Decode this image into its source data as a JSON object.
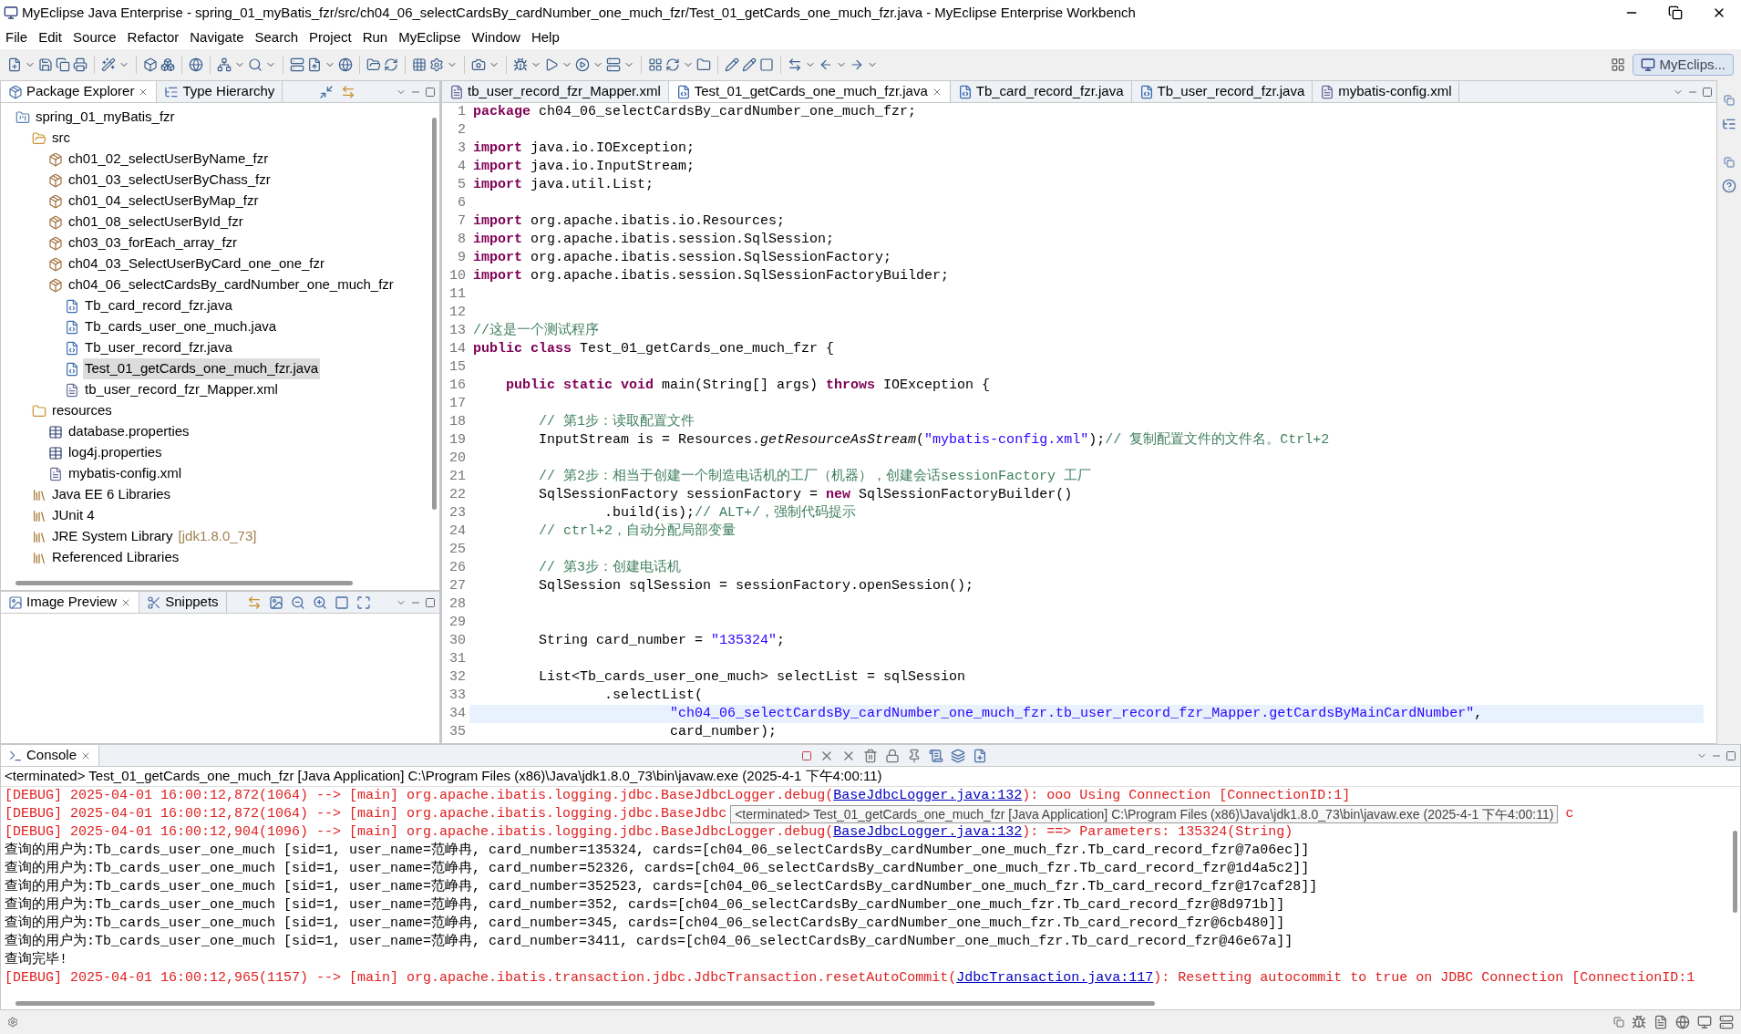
{
  "window": {
    "title": "MyEclipse Java Enterprise - spring_01_myBatis_fzr/src/ch04_06_selectCardsBy_cardNumber_one_much_fzr/Test_01_getCards_one_much_fzr.java - MyEclipse Enterprise Workbench"
  },
  "menu": [
    "File",
    "Edit",
    "Source",
    "Refactor",
    "Navigate",
    "Search",
    "Project",
    "Run",
    "MyEclipse",
    "Window",
    "Help"
  ],
  "perspective": {
    "label": "MyEclips..."
  },
  "explorer": {
    "tabs": [
      {
        "label": "Package Explorer",
        "selected": true
      },
      {
        "label": "Type Hierarchy",
        "selected": false
      }
    ],
    "tree": [
      {
        "label": "spring_01_myBatis_fzr",
        "kind": "project",
        "selected": false,
        "children": [
          {
            "label": "src",
            "kind": "source",
            "selected": false,
            "children": [
              {
                "label": "ch01_02_selectUserByName_fzr",
                "kind": "package",
                "selected": false
              },
              {
                "label": "ch01_03_selectUserByChass_fzr",
                "kind": "package",
                "selected": false
              },
              {
                "label": "ch01_04_selectUserByMap_fzr",
                "kind": "package",
                "selected": false
              },
              {
                "label": "ch01_08_selectUserById_fzr",
                "kind": "package",
                "selected": false
              },
              {
                "label": "ch03_03_forEach_array_fzr",
                "kind": "package",
                "selected": false
              },
              {
                "label": "ch04_03_SelectUserByCard_one_one_fzr",
                "kind": "package",
                "selected": false
              },
              {
                "label": "ch04_06_selectCardsBy_cardNumber_one_much_fzr",
                "kind": "package",
                "selected": false,
                "children": [
                  {
                    "label": "Tb_card_record_fzr.java",
                    "kind": "java",
                    "selected": false
                  },
                  {
                    "label": "Tb_cards_user_one_much.java",
                    "kind": "java",
                    "selected": false
                  },
                  {
                    "label": "Tb_user_record_fzr.java",
                    "kind": "java",
                    "selected": false
                  },
                  {
                    "label": "Test_01_getCards_one_much_fzr.java",
                    "kind": "java",
                    "selected": true
                  },
                  {
                    "label": "tb_user_record_fzr_Mapper.xml",
                    "kind": "xml",
                    "selected": false
                  }
                ]
              }
            ]
          },
          {
            "label": "resources",
            "kind": "folder",
            "selected": false,
            "children": [
              {
                "label": "database.properties",
                "kind": "properties",
                "selected": false
              },
              {
                "label": "log4j.properties",
                "kind": "properties",
                "selected": false
              },
              {
                "label": "mybatis-config.xml",
                "kind": "xml",
                "selected": false
              }
            ]
          },
          {
            "label": "Java EE 6 Libraries",
            "kind": "library",
            "selected": false
          },
          {
            "label": "JUnit 4",
            "kind": "library",
            "selected": false
          },
          {
            "label": "JRE System Library",
            "decoration": "[jdk1.8.0_73]",
            "kind": "library",
            "selected": false
          },
          {
            "label": "Referenced Libraries",
            "kind": "library",
            "selected": false
          }
        ]
      }
    ]
  },
  "preview": {
    "tabs": [
      {
        "label": "Image Preview",
        "selected": true
      },
      {
        "label": "Snippets",
        "selected": false
      }
    ]
  },
  "editor": {
    "tabs": [
      {
        "label": "tb_user_record_fzr_Mapper.xml",
        "kind": "xml",
        "selected": false
      },
      {
        "label": "Test_01_getCards_one_much_fzr.java",
        "kind": "java",
        "selected": true
      },
      {
        "label": "Tb_card_record_fzr.java",
        "kind": "java",
        "selected": false
      },
      {
        "label": "Tb_user_record_fzr.java",
        "kind": "java",
        "selected": false
      },
      {
        "label": "mybatis-config.xml",
        "kind": "xml",
        "selected": false
      }
    ],
    "lines": [
      {
        "n": "1",
        "current": false,
        "segs": [
          {
            "kind": "kw",
            "t": "package"
          },
          {
            "kind": "txt",
            "t": " ch04_06_selectCardsBy_cardNumber_one_much_fzr;"
          }
        ]
      },
      {
        "n": "2",
        "current": false
      },
      {
        "n": "3",
        "current": false,
        "segs": [
          {
            "kind": "kw",
            "t": "import"
          },
          {
            "kind": "txt",
            "t": " java.io.IOException;"
          }
        ]
      },
      {
        "n": "4",
        "current": false,
        "segs": [
          {
            "kind": "kw",
            "t": "import"
          },
          {
            "kind": "txt",
            "t": " java.io.InputStream;"
          }
        ]
      },
      {
        "n": "5",
        "current": false,
        "segs": [
          {
            "kind": "kw",
            "t": "import"
          },
          {
            "kind": "txt",
            "t": " java.util.List;"
          }
        ]
      },
      {
        "n": "6",
        "current": false
      },
      {
        "n": "7",
        "current": false,
        "segs": [
          {
            "kind": "kw",
            "t": "import"
          },
          {
            "kind": "txt",
            "t": " org.apache.ibatis.io.Resources;"
          }
        ]
      },
      {
        "n": "8",
        "current": false,
        "segs": [
          {
            "kind": "kw",
            "t": "import"
          },
          {
            "kind": "txt",
            "t": " org.apache.ibatis.session.SqlSession;"
          }
        ]
      },
      {
        "n": "9",
        "current": false,
        "segs": [
          {
            "kind": "kw",
            "t": "import"
          },
          {
            "kind": "txt",
            "t": " org.apache.ibatis.session.SqlSessionFactory;"
          }
        ]
      },
      {
        "n": "10",
        "current": false,
        "segs": [
          {
            "kind": "kw",
            "t": "import"
          },
          {
            "kind": "txt",
            "t": " org.apache.ibatis.session.SqlSessionFactoryBuilder;"
          }
        ]
      },
      {
        "n": "11",
        "current": false
      },
      {
        "n": "12",
        "current": false
      },
      {
        "n": "13",
        "current": false,
        "segs": [
          {
            "kind": "cm",
            "t": "//这是一个测试程序"
          }
        ]
      },
      {
        "n": "14",
        "current": false,
        "segs": [
          {
            "kind": "kw",
            "t": "public class"
          },
          {
            "kind": "txt",
            "t": " Test_01_getCards_one_much_fzr {"
          }
        ]
      },
      {
        "n": "15",
        "current": false
      },
      {
        "n": "16",
        "current": false,
        "segs": [
          {
            "kind": "kw",
            "t": "    public static void"
          },
          {
            "kind": "txt",
            "t": " main(String[] args) "
          },
          {
            "kind": "kw",
            "t": "throws"
          },
          {
            "kind": "txt",
            "t": " IOException {"
          }
        ]
      },
      {
        "n": "17",
        "current": false
      },
      {
        "n": "18",
        "current": false,
        "segs": [
          {
            "kind": "cm",
            "t": "        // 第1步：读取配置文件"
          }
        ]
      },
      {
        "n": "19",
        "current": false,
        "segs": [
          {
            "kind": "txt",
            "t": "        InputStream is = Resources."
          },
          {
            "kind": "it",
            "t": "getResourceAsStream"
          },
          {
            "kind": "txt",
            "t": "("
          },
          {
            "kind": "str",
            "t": "\"mybatis-config.xml\""
          },
          {
            "kind": "txt",
            "t": ");"
          },
          {
            "kind": "cm",
            "t": "// 复制配置文件的文件名。Ctrl+2"
          }
        ]
      },
      {
        "n": "20",
        "current": false
      },
      {
        "n": "21",
        "current": false,
        "segs": [
          {
            "kind": "cm",
            "t": "        // 第2步：相当于创建一个制造电话机的工厂（机器），创建会话sessionFactory 工厂"
          }
        ]
      },
      {
        "n": "22",
        "current": false,
        "segs": [
          {
            "kind": "txt",
            "t": "        SqlSessionFactory sessionFactory = "
          },
          {
            "kind": "kw",
            "t": "new"
          },
          {
            "kind": "txt",
            "t": " SqlSessionFactoryBuilder()"
          }
        ]
      },
      {
        "n": "23",
        "current": false,
        "segs": [
          {
            "kind": "txt",
            "t": "                .build(is);"
          },
          {
            "kind": "cm",
            "t": "// ALT+/，强制代码提示"
          }
        ]
      },
      {
        "n": "24",
        "current": false,
        "segs": [
          {
            "kind": "cm",
            "t": "        // ctrl+2，自动分配局部变量"
          }
        ]
      },
      {
        "n": "25",
        "current": false
      },
      {
        "n": "26",
        "current": false,
        "segs": [
          {
            "kind": "cm",
            "t": "        // 第3步：创建电话机"
          }
        ]
      },
      {
        "n": "27",
        "current": false,
        "segs": [
          {
            "kind": "txt",
            "t": "        SqlSession sqlSession = sessionFactory.openSession();"
          }
        ]
      },
      {
        "n": "28",
        "current": false
      },
      {
        "n": "29",
        "current": false
      },
      {
        "n": "30",
        "current": false,
        "segs": [
          {
            "kind": "txt",
            "t": "        String card_number = "
          },
          {
            "kind": "str",
            "t": "\"135324\""
          },
          {
            "kind": "txt",
            "t": ";"
          }
        ]
      },
      {
        "n": "31",
        "current": false
      },
      {
        "n": "32",
        "current": false,
        "segs": [
          {
            "kind": "txt",
            "t": "        List<Tb_cards_user_one_much> selectList = sqlSession"
          }
        ]
      },
      {
        "n": "33",
        "current": false,
        "segs": [
          {
            "kind": "txt",
            "t": "                .selectList("
          }
        ]
      },
      {
        "n": "34",
        "current": true,
        "segs": [
          {
            "kind": "str",
            "t": "                        \"ch04_06_selectCardsBy_cardNumber_one_much_fzr.tb_user_record_fzr_Mapper.getCardsByMainCardNumber\""
          },
          {
            "kind": "txt",
            "t": ","
          }
        ]
      },
      {
        "n": "35",
        "current": false,
        "segs": [
          {
            "kind": "txt",
            "t": "                        card_number);"
          }
        ]
      }
    ]
  },
  "console": {
    "tab": {
      "label": "Console",
      "selected": true
    },
    "header": "<terminated> Test_01_getCards_one_much_fzr [Java Application] C:\\Program Files (x86)\\Java\\jdk1.8.0_73\\bin\\javaw.exe (2025-4-1 下午4:00:11)",
    "tooltip": "<terminated> Test_01_getCards_one_much_fzr [Java Application] C:\\Program Files (x86)\\Java\\jdk1.8.0_73\\bin\\javaw.exe (2025-4-1 下午4:00:11)",
    "lines": [
      {
        "kind": "debug",
        "segs": [
          {
            "kind": "txt",
            "t": "[DEBUG] 2025-04-01 16:00:12,872(1064) --> [main] org.apache.ibatis.logging.jdbc.BaseJdbcLogger.debug("
          },
          {
            "kind": "link",
            "t": "BaseJdbcLogger.java:132"
          },
          {
            "kind": "txt",
            "t": "): ooo Using Connection [ConnectionID:1]"
          }
        ]
      },
      {
        "kind": "debug",
        "tooltip": true,
        "segs": [
          {
            "kind": "txt",
            "t": "[DEBUG] 2025-04-01 16:00:12,872(1064) --> [main] org.apache.ibatis.logging.jdbc.BaseJdbc"
          }
        ],
        "tail": "c"
      },
      {
        "kind": "debug",
        "segs": [
          {
            "kind": "txt",
            "t": "[DEBUG] 2025-04-01 16:00:12,904(1096) --> [main] org.apache.ibatis.logging.jdbc.BaseJdbcLogger.debug("
          },
          {
            "kind": "link",
            "t": "BaseJdbcLogger.java:132"
          },
          {
            "kind": "txt",
            "t": "): ==> Parameters: 135324(String)"
          }
        ]
      },
      {
        "kind": "out",
        "segs": [
          {
            "kind": "txt",
            "t": "查询的用户为:Tb_cards_user_one_much [sid=1, user_name=范峥冉, card_number=135324, cards=[ch04_06_selectCardsBy_cardNumber_one_much_fzr.Tb_card_record_fzr@7a06ec]]"
          }
        ]
      },
      {
        "kind": "out",
        "segs": [
          {
            "kind": "txt",
            "t": "查询的用户为:Tb_cards_user_one_much [sid=1, user_name=范峥冉, card_number=52326, cards=[ch04_06_selectCardsBy_cardNumber_one_much_fzr.Tb_card_record_fzr@1d4a5c2]]"
          }
        ]
      },
      {
        "kind": "out",
        "segs": [
          {
            "kind": "txt",
            "t": "查询的用户为:Tb_cards_user_one_much [sid=1, user_name=范峥冉, card_number=352523, cards=[ch04_06_selectCardsBy_cardNumber_one_much_fzr.Tb_card_record_fzr@17caf28]]"
          }
        ]
      },
      {
        "kind": "out",
        "segs": [
          {
            "kind": "txt",
            "t": "查询的用户为:Tb_cards_user_one_much [sid=1, user_name=范峥冉, card_number=352, cards=[ch04_06_selectCardsBy_cardNumber_one_much_fzr.Tb_card_record_fzr@8d971b]]"
          }
        ]
      },
      {
        "kind": "out",
        "segs": [
          {
            "kind": "txt",
            "t": "查询的用户为:Tb_cards_user_one_much [sid=1, user_name=范峥冉, card_number=345, cards=[ch04_06_selectCardsBy_cardNumber_one_much_fzr.Tb_card_record_fzr@6cb480]]"
          }
        ]
      },
      {
        "kind": "out",
        "segs": [
          {
            "kind": "txt",
            "t": "查询的用户为:Tb_cards_user_one_much [sid=1, user_name=范峥冉, card_number=3411, cards=[ch04_06_selectCardsBy_cardNumber_one_much_fzr.Tb_card_record_fzr@46e67a]]"
          }
        ]
      },
      {
        "kind": "out",
        "segs": [
          {
            "kind": "txt",
            "t": "查询完毕!"
          }
        ]
      },
      {
        "kind": "debug",
        "segs": [
          {
            "kind": "txt",
            "t": "[DEBUG] 2025-04-01 16:00:12,965(1157) --> [main] org.apache.ibatis.transaction.jdbc.JdbcTransaction.resetAutoCommit("
          },
          {
            "kind": "link",
            "t": "JdbcTransaction.java:117"
          },
          {
            "kind": "txt",
            "t": "): Resetting autocommit to true on JDBC Connection [ConnectionID:1"
          }
        ]
      }
    ]
  }
}
